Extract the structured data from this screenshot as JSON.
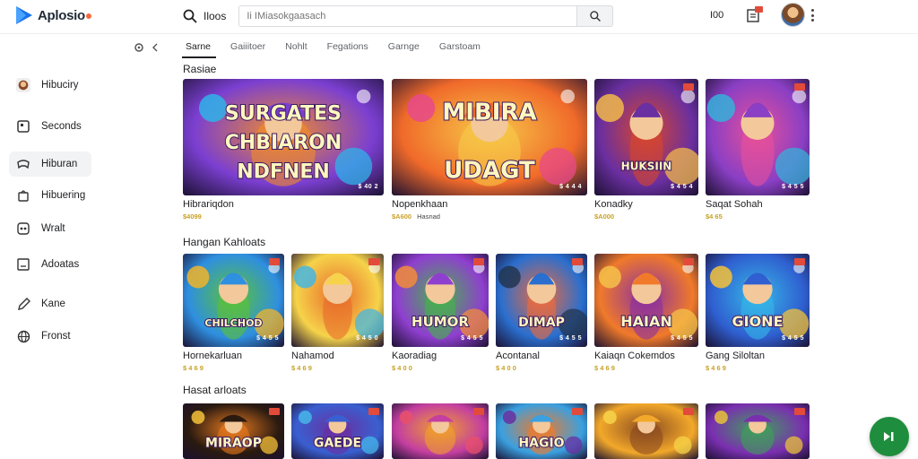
{
  "app": {
    "name": "Aplosio"
  },
  "search": {
    "label": "Iloos",
    "placeholder": "Ii IMiasokgaasach"
  },
  "header": {
    "right_text": "I00"
  },
  "sidebar": {
    "items": [
      {
        "label": "Hibuciry",
        "icon": "avatar-icon"
      },
      {
        "label": "Seconds",
        "icon": "square-icon"
      },
      {
        "label": "Hiburan",
        "icon": "controller-icon"
      },
      {
        "label": "Hibuering",
        "icon": "bag-icon"
      },
      {
        "label": "Wralt",
        "icon": "gamepad-icon"
      },
      {
        "label": "Adoatas",
        "icon": "box-icon"
      },
      {
        "label": "Kane",
        "icon": "pencil-icon"
      },
      {
        "label": "Fronst",
        "icon": "globe-icon"
      }
    ]
  },
  "tabs": [
    {
      "label": "Sarne"
    },
    {
      "label": "Gaiiitoer"
    },
    {
      "label": "Nohlt"
    },
    {
      "label": "Fegations"
    },
    {
      "label": "Garnge"
    },
    {
      "label": "Garstoam"
    }
  ],
  "sections": [
    {
      "title": "Rasiae",
      "cards": [
        {
          "title": "Hibrariqdon",
          "price": "$4099",
          "sub": "",
          "badge": "$ 40 2",
          "art_text": "SURGATES CHBIARON NDFNEN",
          "palette": [
            "#7b3fd1",
            "#f28c28",
            "#2fb3e8"
          ]
        },
        {
          "title": "Nopenkhaan",
          "price": "$A600",
          "sub": "Hasnad",
          "badge": "$ 4 4 4",
          "art_text": "MIBIRA UDAGT",
          "palette": [
            "#f06a2a",
            "#f7c948",
            "#e84a8a"
          ]
        },
        {
          "title": "Konadky",
          "price": "$A000",
          "sub": "",
          "badge": "$ 4 5 4",
          "art_text": "HUKSIIN",
          "palette": [
            "#6a2fa0",
            "#d9462b",
            "#f2b84a"
          ]
        },
        {
          "title": "Saqat Sohah",
          "price": "$4 65",
          "sub": "",
          "badge": "$ 4 5 5",
          "art_text": "",
          "palette": [
            "#8a3fc4",
            "#e8509a",
            "#36b0d8"
          ]
        }
      ]
    },
    {
      "title": "Hangan Kahloats",
      "cards": [
        {
          "title": "Hornekarluan",
          "price": "$ 4 6 9",
          "sub": "",
          "badge": "$ 4 5 5",
          "art_text": "CHILCHOD",
          "palette": [
            "#2f8fe0",
            "#5bc236",
            "#f0b429"
          ]
        },
        {
          "title": "Nahamod",
          "price": "$ 4 6 9",
          "sub": "",
          "badge": "$ 4 5 0",
          "art_text": "",
          "palette": [
            "#f6d34a",
            "#e86a2a",
            "#46b6e0"
          ]
        },
        {
          "title": "Kaoradiag",
          "price": "$ 4 0 0",
          "sub": "",
          "badge": "$ 4 5 5",
          "art_text": "HUMOR",
          "palette": [
            "#8f3fcf",
            "#45b44a",
            "#f28c3a"
          ]
        },
        {
          "title": "Acontanal",
          "price": "$ 4 0 0",
          "sub": "",
          "badge": "$ 4 5 5",
          "art_text": "DIMAP",
          "palette": [
            "#2a6fcf",
            "#f06a3a",
            "#23354f"
          ]
        },
        {
          "title": "Kaiaqn Cokemdos",
          "price": "$ 4 6 9",
          "sub": "",
          "badge": "$ 4 5 5",
          "art_text": "HAIAN",
          "palette": [
            "#f07a2a",
            "#8a2fa0",
            "#f4c14a"
          ]
        },
        {
          "title": "Gang Siloltan",
          "price": "$ 4 6 9",
          "sub": "",
          "badge": "$ 4 5 5",
          "art_text": "GIONE",
          "palette": [
            "#2f5fd0",
            "#36b8e8",
            "#f3c23a"
          ]
        }
      ]
    },
    {
      "title": "Hasat arloats",
      "cards": [
        {
          "title": "",
          "price": "",
          "sub": "",
          "badge": "",
          "art_text": "MIRAOP",
          "palette": [
            "#2a1a10",
            "#e87a20",
            "#f6c23a"
          ]
        },
        {
          "title": "",
          "price": "",
          "sub": "",
          "badge": "",
          "art_text": "GAEDE",
          "palette": [
            "#3a5fd0",
            "#6a2fa0",
            "#46b6e8"
          ]
        },
        {
          "title": "",
          "price": "",
          "sub": "",
          "badge": "",
          "art_text": "",
          "palette": [
            "#c43fa0",
            "#f0a02a",
            "#e8506a"
          ]
        },
        {
          "title": "",
          "price": "",
          "sub": "",
          "badge": "",
          "art_text": "HAGIO",
          "palette": [
            "#3aa0e0",
            "#f07a2a",
            "#6a2fa0"
          ]
        },
        {
          "title": "",
          "price": "",
          "sub": "",
          "badge": "",
          "art_text": "",
          "palette": [
            "#f2a82a",
            "#8a4a20",
            "#f6d34a"
          ]
        },
        {
          "title": "",
          "price": "",
          "sub": "",
          "badge": "",
          "art_text": "",
          "palette": [
            "#7a2fb0",
            "#3fa05a",
            "#e8c23a"
          ]
        }
      ]
    }
  ],
  "colors": {
    "accent": "#1e8e3e",
    "active_tab": "#202124",
    "price": "#c9a227",
    "logo_blue": "#1a73e8",
    "logo_dot": "#f26b3a"
  }
}
